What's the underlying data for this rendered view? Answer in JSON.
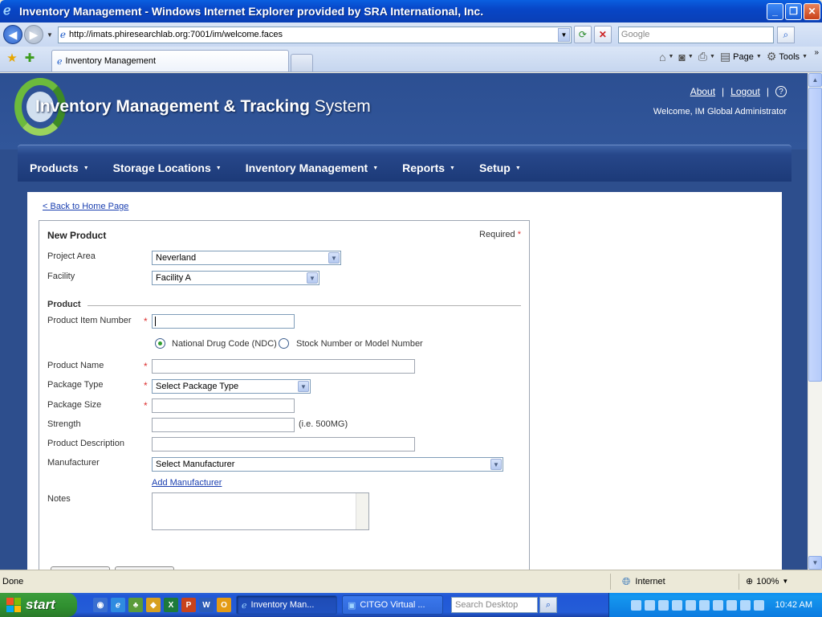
{
  "window": {
    "title": "Inventory Management - Windows Internet Explorer provided by SRA International, Inc.",
    "minimize": "_",
    "maximize": "❐",
    "close": "✕"
  },
  "addressbar": {
    "url": "http://imats.phiresearchlab.org:7001/im/welcome.faces",
    "search_placeholder": "Google"
  },
  "tabs": {
    "active_label": "Inventory Management"
  },
  "toolbar": {
    "page_label": "Page",
    "tools_label": "Tools",
    "more": "»"
  },
  "app": {
    "brand_main": "Inventory Management & Tracking",
    "brand_system": "System",
    "about": "About",
    "logout": "Logout",
    "help": "?",
    "welcome": "Welcome, IM Global Administrator",
    "menu": [
      "Products",
      "Storage Locations",
      "Inventory Management",
      "Reports",
      "Setup"
    ]
  },
  "page": {
    "back_link": "< Back to Home Page",
    "form_title": "New Product",
    "required_label": "Required",
    "required_star": "*",
    "section_product": "Product",
    "fields": {
      "project_area_label": "Project Area",
      "project_area_value": "Neverland",
      "facility_label": "Facility",
      "facility_value": "Facility A",
      "item_number_label": "Product Item Number",
      "radio_ndc": "National Drug Code (NDC)",
      "radio_stock": "Stock Number or Model Number",
      "product_name_label": "Product Name",
      "package_type_label": "Package Type",
      "package_type_value": "Select Package Type",
      "package_size_label": "Package Size",
      "strength_label": "Strength",
      "strength_hint": "(i.e. 500MG)",
      "description_label": "Product Description",
      "manufacturer_label": "Manufacturer",
      "manufacturer_value": "Select Manufacturer",
      "add_manufacturer": "Add Manufacturer",
      "notes_label": "Notes"
    }
  },
  "statusbar": {
    "status": "Done",
    "zone": "Internet",
    "zoom": "100%"
  },
  "taskbar": {
    "start": "start",
    "tasks": [
      "Inventory Man...",
      "CITGO Virtual ..."
    ],
    "desktop_search_placeholder": "Search Desktop",
    "clock": "10:42 AM"
  }
}
